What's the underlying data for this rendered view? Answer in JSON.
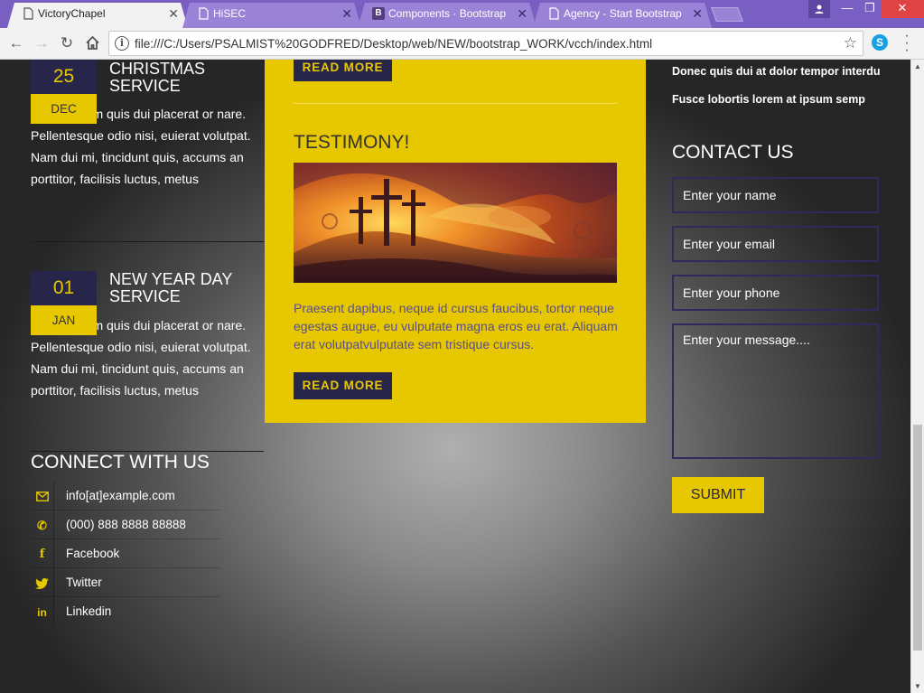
{
  "browser": {
    "tabs": [
      {
        "title": "VictoryChapel",
        "active": true
      },
      {
        "title": "HiSEC",
        "active": false
      },
      {
        "title": "Components · Bootstrap",
        "active": false
      },
      {
        "title": "Agency - Start Bootstrap",
        "active": false
      }
    ],
    "url": "file:///C:/Users/PSALMIST%20GODFRED/Desktop/web/NEW/bootstrap_WORK/vcch/index.html",
    "favicon_letter": "B"
  },
  "events": [
    {
      "day": "25",
      "month": "DEC",
      "title": "CHRISTMAS SERVICE",
      "body": "Morbi in sem quis dui placerat or nare. Pellentesque odio nisi, euierat volutpat. Nam dui mi, tincidunt quis, accums an porttitor, facilisis luctus, metus"
    },
    {
      "day": "01",
      "month": "JAN",
      "title": "NEW YEAR DAY SERVICE",
      "body": "Morbi in sem quis dui placerat or nare. Pellentesque odio nisi, euierat volutpat. Nam dui mi, tincidunt quis, accums an porttitor, facilisis luctus, metus"
    }
  ],
  "connect": {
    "title": "CONNECT WITH US",
    "items": [
      {
        "icon": "envelope-icon",
        "text": "info[at]example.com"
      },
      {
        "icon": "phone-icon",
        "text": "(000) 888 8888 88888"
      },
      {
        "icon": "facebook-icon",
        "text": "Facebook"
      },
      {
        "icon": "twitter-icon",
        "text": "Twitter"
      },
      {
        "icon": "linkedin-icon",
        "text": "Linkedin"
      }
    ]
  },
  "testimony": {
    "read_more_top": "READ MORE",
    "title": "TESTIMONY!",
    "image_alt": "three crosses on a hill",
    "text": "Praesent dapibus, neque id cursus faucibus, tortor neque egestas augue, eu vulputate magna eros eu erat. Aliquam erat volutpatvulputate sem tristique cursus.",
    "read_more": "READ MORE"
  },
  "right": {
    "links": [
      "Donec quis dui at dolor tempor interdu",
      "Fusce lobortis lorem at ipsum semp"
    ],
    "contact_title": "CONTACT US",
    "name_placeholder": "Enter your name",
    "email_placeholder": "Enter your email",
    "phone_placeholder": "Enter your phone",
    "message_placeholder": "Enter your message....",
    "submit": "SUBMIT"
  },
  "colors": {
    "accent_yellow": "#e6c700",
    "navy": "#28254a",
    "tabbar": "#7a5fc3"
  }
}
